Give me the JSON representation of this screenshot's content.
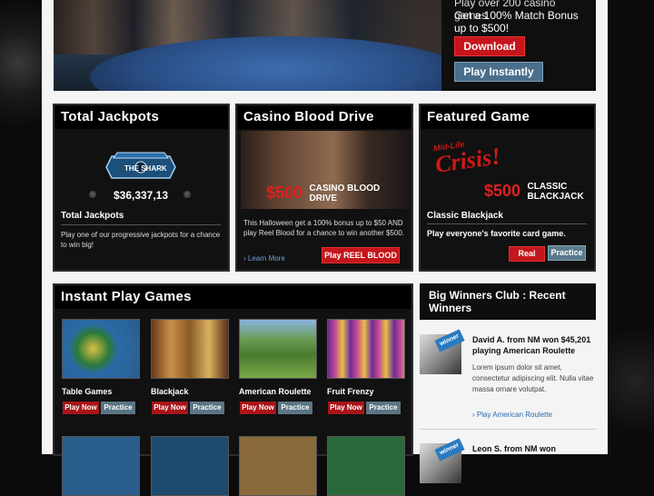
{
  "hero": {
    "overflow_line": "Play over 200 casino games",
    "bonus_line": "Get a 100% Match Bonus up to $500!",
    "download_label": "Download",
    "play_instantly_label": "Play Instantly"
  },
  "jackpots": {
    "title": "Total Jackpots",
    "logo_text": "THE SHARK",
    "amount": "$36,337,13",
    "prev_icon": "chevron-left-icon",
    "next_icon": "chevron-right-icon",
    "desc_title": "Total Jackpots",
    "desc": "Play one of our progressive jackpots for a chance to win big!"
  },
  "blood_drive": {
    "title": "Casino Blood Drive",
    "amount": "$500",
    "caption": "CASINO BLOOD DRIVE",
    "desc": "This Halloween get a 100% bonus up to $50 AND play Reel Blood for a chance to win another $500.",
    "learn_more": "› Learn More",
    "play_label": "Play REEL BLOOD"
  },
  "featured": {
    "title": "Featured Game",
    "logo_small": "Mid-Life",
    "logo_big": "Crisis!",
    "amount": "$500",
    "caption_line1": "CLASSIC",
    "caption_line2": "BLACKJACK",
    "desc_title": "Classic Blackjack",
    "desc": "Play everyone's favorite card game.",
    "real_label": "Real",
    "practice_label": "Practice"
  },
  "instant": {
    "title": "Instant Play Games",
    "games": [
      {
        "name": "Table Games",
        "play": "Play Now",
        "practice": "Practice"
      },
      {
        "name": "Blackjack",
        "play": "Play Now",
        "practice": "Practice"
      },
      {
        "name": "American Roulette",
        "play": "Play Now",
        "practice": "Practice"
      },
      {
        "name": "Fruit Frenzy",
        "play": "Play Now",
        "practice": "Practice"
      }
    ]
  },
  "winners": {
    "title": "Big Winners Club : Recent Winners",
    "tag": "winner",
    "entries": [
      {
        "headline": "David A. from NM won $45,201 playing American Roulette",
        "body": "Lorem ipsum dolor sit amet, consectetur adipiscing elit. Nulla vitae massa ornare volutpat.",
        "link": "› Play American Roulette"
      },
      {
        "headline": "Leon S. from NM won"
      }
    ]
  }
}
